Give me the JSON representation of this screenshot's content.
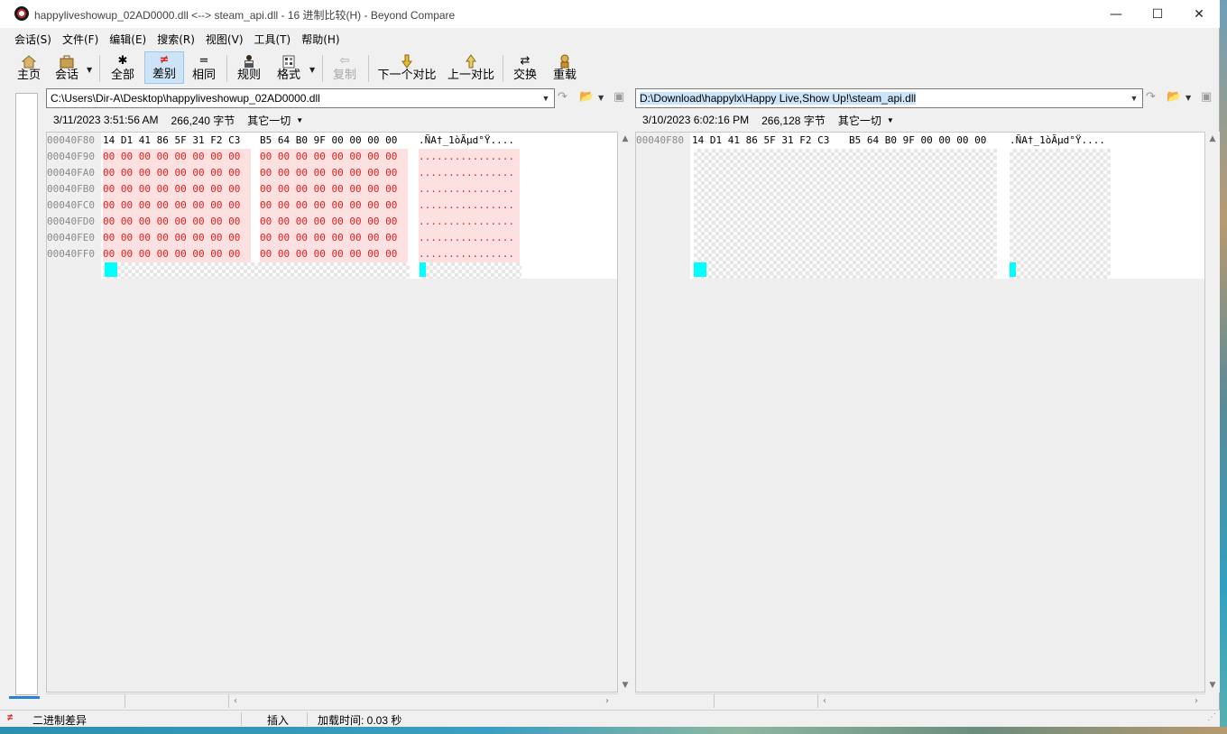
{
  "window": {
    "title": "happyliveshowup_02AD0000.dll <--> steam_api.dll - 16 进制比较(H) - Beyond Compare",
    "minimize": "—",
    "maximize": "☐",
    "close": "✕"
  },
  "menu": [
    "会话(S)",
    "文件(F)",
    "编辑(E)",
    "搜索(R)",
    "视图(V)",
    "工具(T)",
    "帮助(H)"
  ],
  "toolbar": {
    "home": "主页",
    "session": "会话",
    "all": "全部",
    "diffs": "差别",
    "same": "相同",
    "rules": "规则",
    "format": "格式",
    "copy": "复制",
    "next_diff": "下一个对比",
    "prev_diff": "上一对比",
    "swap": "交换",
    "reload": "重载",
    "active": "差别"
  },
  "left": {
    "path": "C:\\Users\\Dir-A\\Desktop\\happyliveshowup_02AD0000.dll",
    "date": "3/11/2023 3:51:56 AM",
    "size": "266,240 字节",
    "other": "其它一切",
    "rows": [
      {
        "addr": "00040F80",
        "b1": "14 D1 41 86 5F 31 F2 C3",
        "b2": "B5 64 B0 9F 00 00 00 00",
        "ascii": ".ÑA†_1òÃµd°Ÿ....",
        "diff": false
      },
      {
        "addr": "00040F90",
        "b1": "00 00 00 00 00 00 00 00",
        "b2": "00 00 00 00 00 00 00 00",
        "ascii": "................",
        "diff": true
      },
      {
        "addr": "00040FA0",
        "b1": "00 00 00 00 00 00 00 00",
        "b2": "00 00 00 00 00 00 00 00",
        "ascii": "................",
        "diff": true
      },
      {
        "addr": "00040FB0",
        "b1": "00 00 00 00 00 00 00 00",
        "b2": "00 00 00 00 00 00 00 00",
        "ascii": "................",
        "diff": true
      },
      {
        "addr": "00040FC0",
        "b1": "00 00 00 00 00 00 00 00",
        "b2": "00 00 00 00 00 00 00 00",
        "ascii": "................",
        "diff": true
      },
      {
        "addr": "00040FD0",
        "b1": "00 00 00 00 00 00 00 00",
        "b2": "00 00 00 00 00 00 00 00",
        "ascii": "................",
        "diff": true
      },
      {
        "addr": "00040FE0",
        "b1": "00 00 00 00 00 00 00 00",
        "b2": "00 00 00 00 00 00 00 00",
        "ascii": "................",
        "diff": true
      },
      {
        "addr": "00040FF0",
        "b1": "00 00 00 00 00 00 00 00",
        "b2": "00 00 00 00 00 00 00 00",
        "ascii": "................",
        "diff": true
      }
    ]
  },
  "right": {
    "path": "D:\\Download\\happylx\\Happy Live,Show Up!\\steam_api.dll",
    "date": "3/10/2023 6:02:16 PM",
    "size": "266,128 字节",
    "other": "其它一切",
    "rows": [
      {
        "addr": "00040F80",
        "b1": "14 D1 41 86 5F 31 F2 C3",
        "b2": "B5 64 B0 9F 00 00 00 00",
        "ascii": ".ÑA†_1òÃµd°Ÿ....",
        "diff": false
      }
    ]
  },
  "status": {
    "diff_label": "二进制差异",
    "mode": "插入",
    "load_time": "加载时间:  0.03 秒"
  },
  "colors": {
    "diff_text": "#e02020",
    "diff_bg": "#fde0e0",
    "cursor": "#00ffff",
    "active_button": "#cde4f7"
  }
}
